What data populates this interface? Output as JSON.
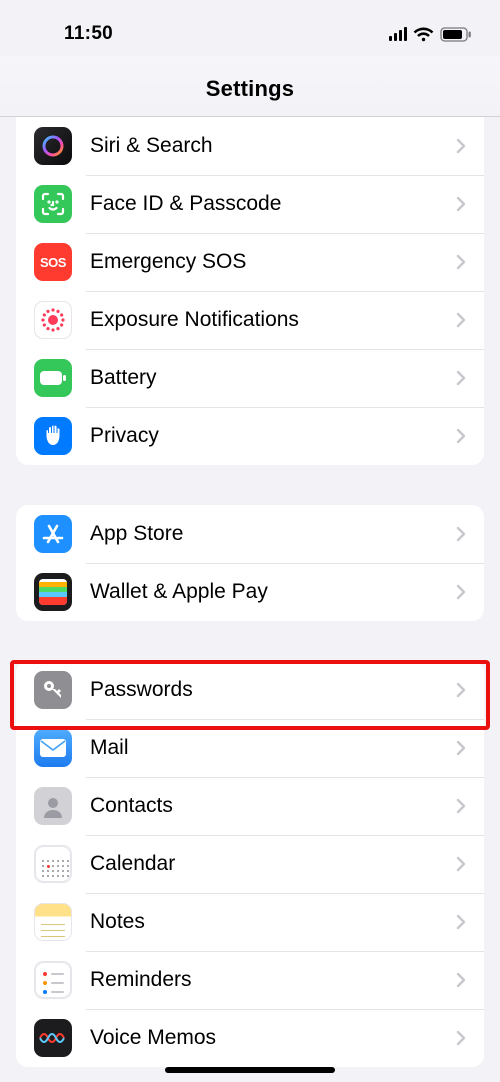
{
  "statusBar": {
    "time": "11:50"
  },
  "header": {
    "title": "Settings"
  },
  "groups": [
    {
      "id": "g1",
      "items": [
        {
          "id": "siri",
          "label": "Siri & Search",
          "icon": "siri-icon",
          "bg": "linear-gradient(135deg,#2b2b2f,#0b0b0d)",
          "accent": "multi"
        },
        {
          "id": "faceid",
          "label": "Face ID & Passcode",
          "icon": "faceid-icon",
          "bg": "#34c759"
        },
        {
          "id": "sos",
          "label": "Emergency SOS",
          "icon": "sos-icon",
          "bg": "#ff3b30",
          "text": "SOS"
        },
        {
          "id": "exposure",
          "label": "Exposure Notifications",
          "icon": "exposure-icon",
          "bg": "#ffffff",
          "dotted": true
        },
        {
          "id": "battery",
          "label": "Battery",
          "icon": "battery-icon",
          "bg": "#34c759"
        },
        {
          "id": "privacy",
          "label": "Privacy",
          "icon": "privacy-hand-icon",
          "bg": "#007aff"
        }
      ]
    },
    {
      "id": "g2",
      "items": [
        {
          "id": "appstore",
          "label": "App Store",
          "icon": "appstore-icon",
          "bg": "#1e90ff"
        },
        {
          "id": "wallet",
          "label": "Wallet & Apple Pay",
          "icon": "wallet-icon",
          "bg": "#1c1c1e"
        }
      ]
    },
    {
      "id": "g3",
      "items": [
        {
          "id": "passwords",
          "label": "Passwords",
          "icon": "key-icon",
          "bg": "#8e8e93",
          "highlighted": true
        },
        {
          "id": "mail",
          "label": "Mail",
          "icon": "mail-icon",
          "bg": "linear-gradient(#4facfe,#1e7cf0)"
        },
        {
          "id": "contacts",
          "label": "Contacts",
          "icon": "contacts-icon",
          "bg": "#d1d1d6"
        },
        {
          "id": "calendar",
          "label": "Calendar",
          "icon": "calendar-icon",
          "bg": "#ffffff",
          "cal": true
        },
        {
          "id": "notes",
          "label": "Notes",
          "icon": "notes-icon",
          "bg": "linear-gradient(#ffe18a 35%,#ffffff 35%)"
        },
        {
          "id": "reminders",
          "label": "Reminders",
          "icon": "reminders-icon",
          "bg": "#ffffff",
          "list": true
        },
        {
          "id": "voicememos",
          "label": "Voice Memos",
          "icon": "voicememo-icon",
          "bg": "#1c1c1e",
          "wave": true
        }
      ]
    }
  ]
}
